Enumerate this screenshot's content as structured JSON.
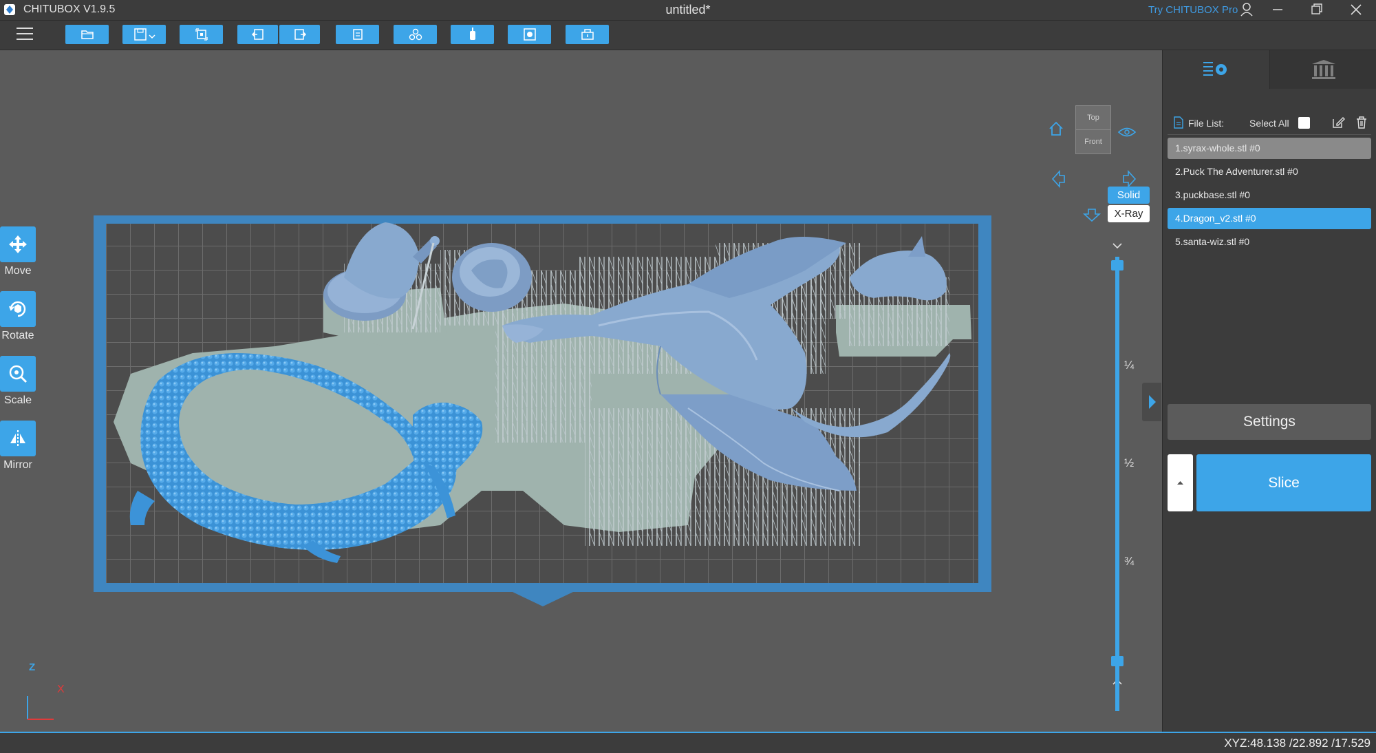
{
  "titlebar": {
    "app_name": "CHITUBOX V1.9.5",
    "doc_title": "untitled*",
    "try_pro": "Try CHITUBOX Pro"
  },
  "toolbar": {
    "buttons": [
      "open-icon",
      "save-icon",
      "import-icon",
      "undo-icon",
      "redo-icon",
      "copy-icon",
      "arrange-icon",
      "support-icon",
      "hollow-icon",
      "machine-icon"
    ]
  },
  "left_tools": [
    {
      "label": "Move",
      "icon": "move-icon"
    },
    {
      "label": "Rotate",
      "icon": "rotate-icon"
    },
    {
      "label": "Scale",
      "icon": "scale-icon"
    },
    {
      "label": "Mirror",
      "icon": "mirror-icon"
    }
  ],
  "view": {
    "cube_top": "Top",
    "cube_front": "Front",
    "solid_label": "Solid",
    "xray_label": "X-Ray"
  },
  "slider": {
    "marks": [
      "¼",
      "½",
      "¾"
    ]
  },
  "axes": {
    "z": "Z",
    "x": "X"
  },
  "panel": {
    "file_list_label": "File List:",
    "select_all_label": "Select All",
    "files": [
      {
        "name": "1.syrax-whole.stl #0",
        "state": "hover"
      },
      {
        "name": "2.Puck The Adventurer.stl #0",
        "state": "normal"
      },
      {
        "name": "3.puckbase.stl #0",
        "state": "normal"
      },
      {
        "name": "4.Dragon_v2.stl #0",
        "state": "selected"
      },
      {
        "name": "5.santa-wiz.stl #0",
        "state": "normal"
      }
    ],
    "settings_label": "Settings",
    "slice_label": "Slice"
  },
  "status": {
    "xyz": "XYZ:48.138 /22.892 /17.529"
  },
  "colors": {
    "accent": "#3da5e8",
    "model": "#88a9cf",
    "serpent": "#3c93d8",
    "support": "#c8d2d6",
    "raft": "#9fb3ad",
    "plate": "#4a4a4a",
    "plate_border": "#3f86c0"
  }
}
